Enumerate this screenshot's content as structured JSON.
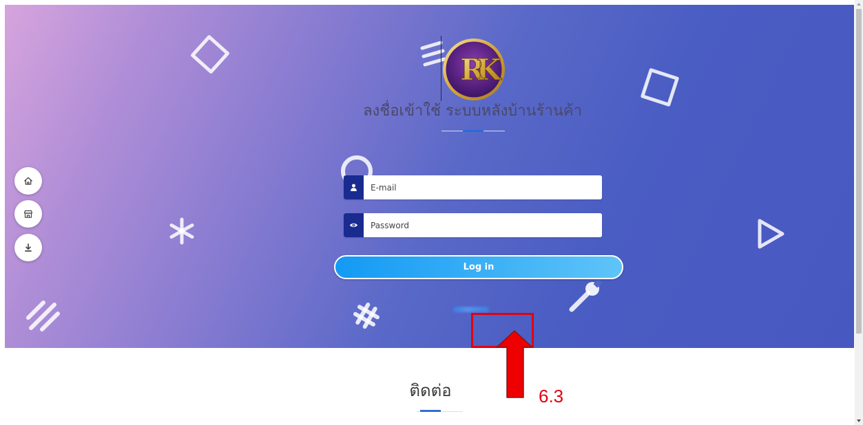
{
  "logo": {
    "monogram": "RK"
  },
  "login": {
    "title": "ลงชื่อเข้าใช้ ระบบหลังบ้านร้านค้า",
    "email": {
      "placeholder": "E-mail",
      "icon": "user-icon"
    },
    "password": {
      "placeholder": "Password",
      "icon": "eye-icon"
    },
    "submit_label": "Log in"
  },
  "side_nav": [
    {
      "icon": "home-icon"
    },
    {
      "icon": "store-icon"
    },
    {
      "icon": "download-icon"
    }
  ],
  "contact": {
    "heading": "ติดต่อ"
  },
  "annotation": {
    "step_label": "6.3"
  },
  "colors": {
    "hero_start": "#d6a4dd",
    "hero_end": "#4858c1",
    "input_icon_bg": "#1a2b8f",
    "button_start": "#139af4",
    "button_end": "#5fc4f8",
    "accent_blue": "#2b6ad8",
    "annotation_red": "#e3000f"
  }
}
